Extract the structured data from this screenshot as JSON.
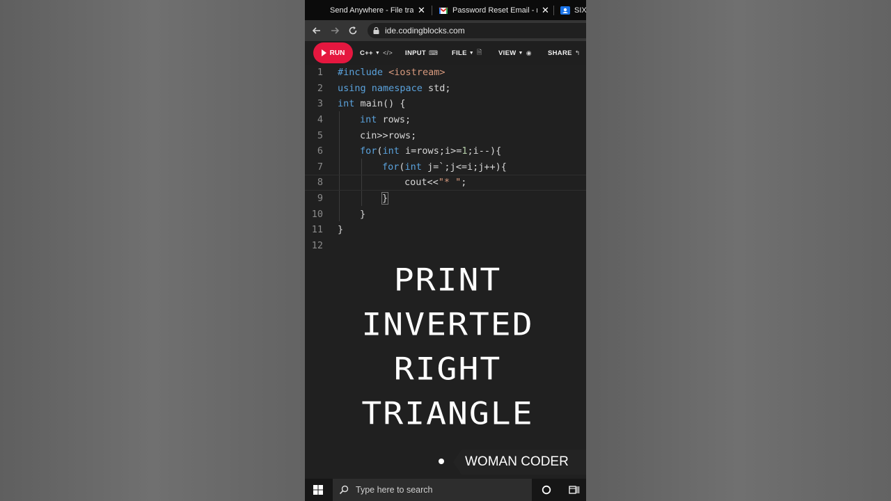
{
  "browser": {
    "tabs": [
      {
        "title": "Send Anywhere - File transf",
        "close": "✕"
      },
      {
        "title": "Password Reset Email - me",
        "close": "✕"
      },
      {
        "title": "SIX"
      }
    ],
    "url": "ide.codingblocks.com"
  },
  "toolbar": {
    "run_label": "RUN",
    "language_label": "C++",
    "input_label": "INPUT",
    "file_label": "FILE",
    "view_label": "VIEW",
    "share_label": "SHARE"
  },
  "editor": {
    "line_numbers": [
      "1",
      "2",
      "3",
      "4",
      "5",
      "6",
      "7",
      "8",
      "9",
      "10",
      "11",
      "12"
    ],
    "active_line": 8
  },
  "overlay": {
    "title_lines": [
      "PRINT",
      "INVERTED",
      "RIGHT",
      "TRIANGLE"
    ],
    "watermark": "WOMAN CODER"
  },
  "taskbar": {
    "search_placeholder": "Type here to search"
  },
  "colors": {
    "run_button": "#e5173f",
    "keyword": "#5aa2dc",
    "string": "#d89a7e",
    "number": "#b5cea8",
    "editor_bg": "#202020"
  }
}
